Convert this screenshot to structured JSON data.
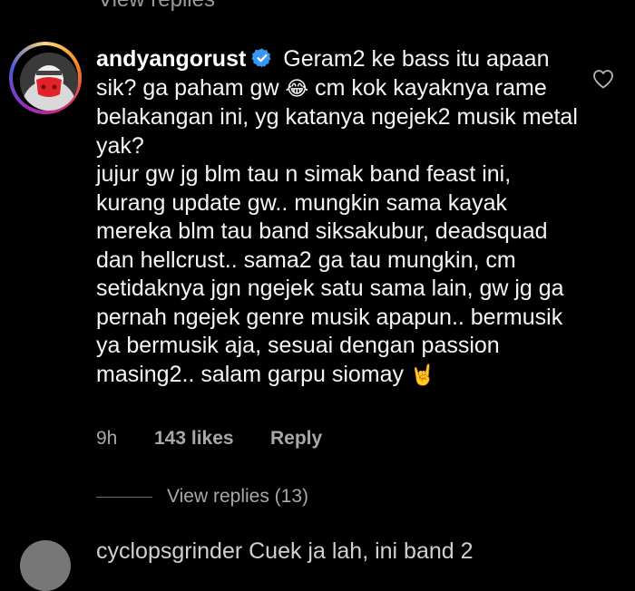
{
  "previous": {
    "partial_text": "View replies"
  },
  "comment": {
    "username": "andyangorust",
    "verified_icon": "verified-badge-icon",
    "text_part1": " Geram2 ke bass itu apaan sik? ga paham gw ",
    "emoji_laugh": "😂",
    "text_part2": " cm kok kayaknya rame belakangan ini, yg katanya ngejek2 musik metal yak?",
    "text_part3": "jujur gw jg blm tau n simak band feast ini, kurang update gw.. mungkin sama kayak mereka blm tau band siksakubur, deadsquad dan hellcrust.. sama2 ga tau mungkin, cm setidaknya jgn ngejek satu sama lain, gw jg ga pernah ngejek genre musik apapun.. bermusik ya bermusik aja, sesuai dengan passion masing2.. salam garpu siomay ",
    "emoji_horns": "🤘",
    "time": "9h",
    "likes": "143 likes",
    "reply_label": "Reply",
    "like_icon": "heart-outline-icon"
  },
  "view_replies": {
    "label": "View replies (13)"
  },
  "next_comment": {
    "partial_text": "cyclopsgrinder  Cuek ja lah, ini band 2"
  },
  "colors": {
    "background": "#000000",
    "text": "#f5f5f5",
    "secondary": "#a8a8a8",
    "verified": "#3897f0"
  }
}
